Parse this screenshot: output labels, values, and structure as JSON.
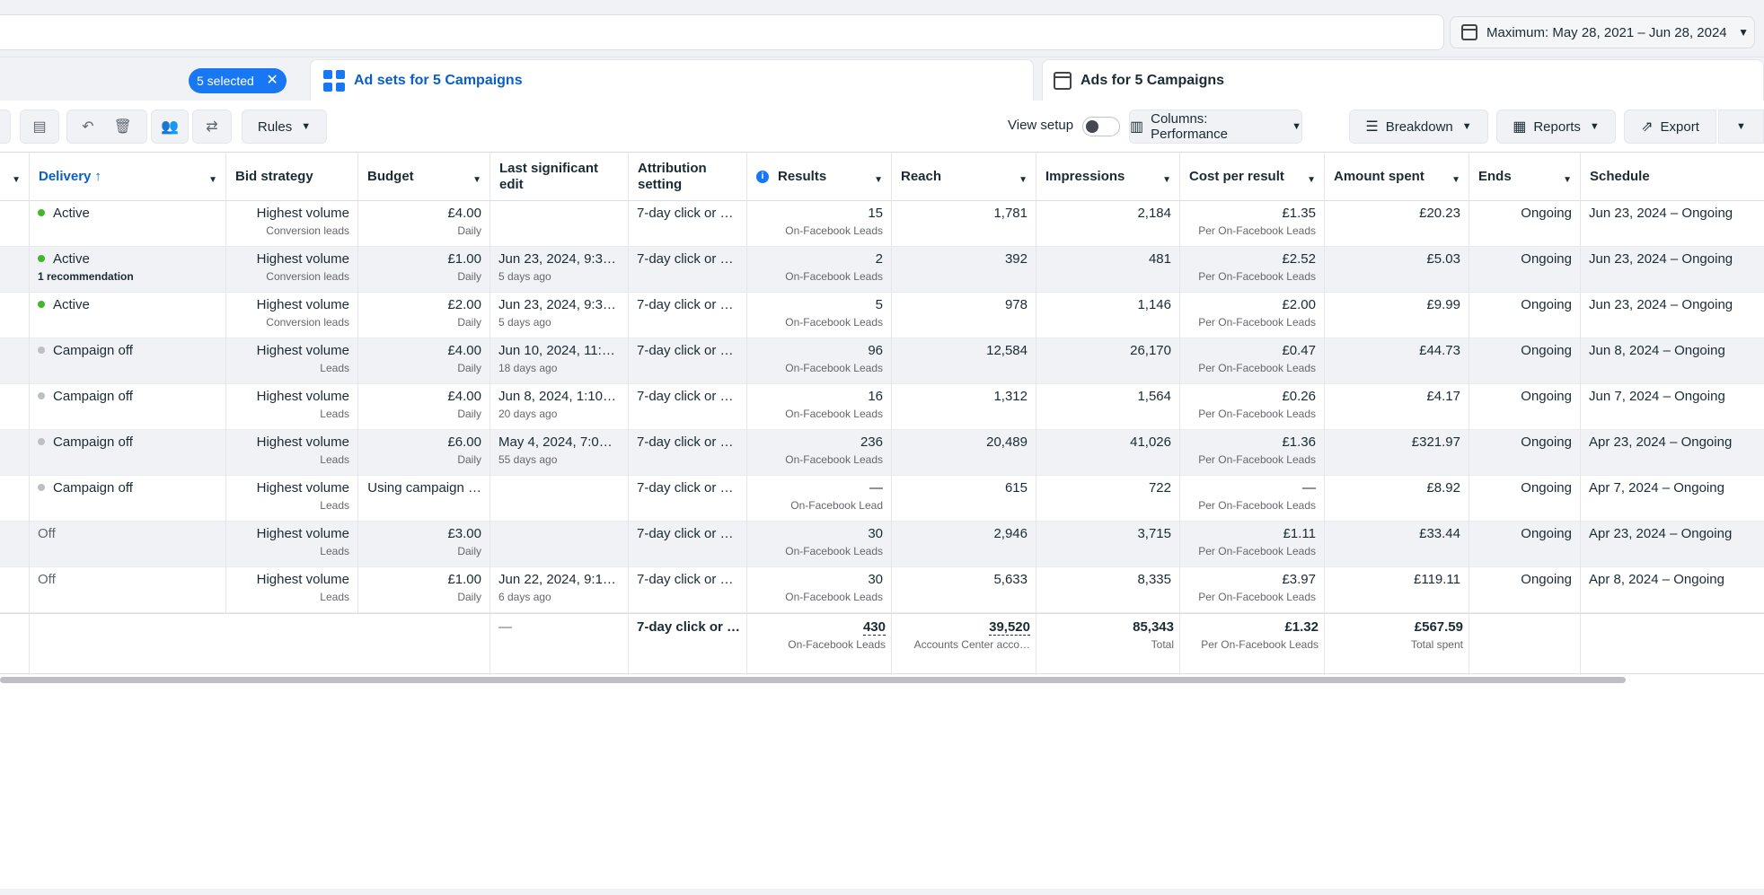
{
  "date_range": {
    "label": "Maximum: May 28, 2021 – Jun 28, 2024"
  },
  "selection": {
    "chip_label": "5 selected",
    "clear": "✕"
  },
  "tabs": {
    "adsets": "Ad sets for 5 Campaigns",
    "ads": "Ads for 5 Campaigns"
  },
  "toolbar": {
    "rules": "Rules",
    "view_setup": "View setup",
    "columns": "Columns: Performance",
    "breakdown": "Breakdown",
    "reports": "Reports",
    "export": "Export"
  },
  "columns": {
    "delivery": "Delivery",
    "bid_strategy": "Bid strategy",
    "budget": "Budget",
    "last_edit": "Last significant edit",
    "attribution": "Attribution setting",
    "results": "Results",
    "reach": "Reach",
    "impressions": "Impressions",
    "cost_per_result": "Cost per result",
    "amount_spent": "Amount spent",
    "ends": "Ends",
    "schedule": "Schedule"
  },
  "rows": [
    {
      "delivery": "Active",
      "delivery_sub": "",
      "status": "active",
      "bid": "Highest volume",
      "bid_sub": "Conversion leads",
      "budget": "£4.00",
      "budget_sub": "Daily",
      "edit": "",
      "edit_sub": "",
      "attribution": "7-day click or 1…",
      "results": "15",
      "results_sub": "On-Facebook Leads",
      "reach": "1,781",
      "impressions": "2,184",
      "cpr": "£1.35",
      "cpr_sub": "Per On-Facebook Leads",
      "spent": "£20.23",
      "ends": "Ongoing",
      "schedule": "Jun 23, 2024 – Ongoing"
    },
    {
      "delivery": "Active",
      "delivery_sub": "1 recommendation",
      "status": "active",
      "bid": "Highest volume",
      "bid_sub": "Conversion leads",
      "budget": "£1.00",
      "budget_sub": "Daily",
      "edit": "Jun 23, 2024, 9:3…",
      "edit_sub": "5 days ago",
      "attribution": "7-day click or 1…",
      "results": "2",
      "results_sub": "On-Facebook Leads",
      "reach": "392",
      "impressions": "481",
      "cpr": "£2.52",
      "cpr_sub": "Per On-Facebook Leads",
      "spent": "£5.03",
      "ends": "Ongoing",
      "schedule": "Jun 23, 2024 – Ongoing"
    },
    {
      "delivery": "Active",
      "delivery_sub": "",
      "status": "active",
      "bid": "Highest volume",
      "bid_sub": "Conversion leads",
      "budget": "£2.00",
      "budget_sub": "Daily",
      "edit": "Jun 23, 2024, 9:3…",
      "edit_sub": "5 days ago",
      "attribution": "7-day click or 1…",
      "results": "5",
      "results_sub": "On-Facebook Leads",
      "reach": "978",
      "impressions": "1,146",
      "cpr": "£2.00",
      "cpr_sub": "Per On-Facebook Leads",
      "spent": "£9.99",
      "ends": "Ongoing",
      "schedule": "Jun 23, 2024 – Ongoing"
    },
    {
      "delivery": "Campaign off",
      "delivery_sub": "",
      "status": "campaign-off",
      "bid": "Highest volume",
      "bid_sub": "Leads",
      "budget": "£4.00",
      "budget_sub": "Daily",
      "edit": "Jun 10, 2024, 11:…",
      "edit_sub": "18 days ago",
      "attribution": "7-day click or 1…",
      "results": "96",
      "results_sub": "On-Facebook Leads",
      "reach": "12,584",
      "impressions": "26,170",
      "cpr": "£0.47",
      "cpr_sub": "Per On-Facebook Leads",
      "spent": "£44.73",
      "ends": "Ongoing",
      "schedule": "Jun 8, 2024 – Ongoing"
    },
    {
      "delivery": "Campaign off",
      "delivery_sub": "",
      "status": "campaign-off",
      "bid": "Highest volume",
      "bid_sub": "Leads",
      "budget": "£4.00",
      "budget_sub": "Daily",
      "edit": "Jun 8, 2024, 1:10 …",
      "edit_sub": "20 days ago",
      "attribution": "7-day click or 1…",
      "results": "16",
      "results_sub": "On-Facebook Leads",
      "reach": "1,312",
      "impressions": "1,564",
      "cpr": "£0.26",
      "cpr_sub": "Per On-Facebook Leads",
      "spent": "£4.17",
      "ends": "Ongoing",
      "schedule": "Jun 7, 2024 – Ongoing"
    },
    {
      "delivery": "Campaign off",
      "delivery_sub": "",
      "status": "campaign-off",
      "bid": "Highest volume",
      "bid_sub": "Leads",
      "budget": "£6.00",
      "budget_sub": "Daily",
      "edit": "May 4, 2024, 7:06 …",
      "edit_sub": "55 days ago",
      "attribution": "7-day click or 1…",
      "results": "236",
      "results_sub": "On-Facebook Leads",
      "reach": "20,489",
      "impressions": "41,026",
      "cpr": "£1.36",
      "cpr_sub": "Per On-Facebook Leads",
      "spent": "£321.97",
      "ends": "Ongoing",
      "schedule": "Apr 23, 2024 – Ongoing"
    },
    {
      "delivery": "Campaign off",
      "delivery_sub": "",
      "status": "campaign-off",
      "bid": "Highest volume",
      "bid_sub": "Leads",
      "budget": "Using campaign …",
      "budget_sub": "",
      "edit": "",
      "edit_sub": "",
      "attribution": "7-day click or 1…",
      "results": "—",
      "results_sub": "On-Facebook Lead",
      "reach": "615",
      "impressions": "722",
      "cpr": "—",
      "cpr_sub": "Per On-Facebook Leads",
      "spent": "£8.92",
      "ends": "Ongoing",
      "schedule": "Apr 7, 2024 – Ongoing"
    },
    {
      "delivery": "Off",
      "delivery_sub": "",
      "status": "off",
      "bid": "Highest volume",
      "bid_sub": "Leads",
      "budget": "£3.00",
      "budget_sub": "Daily",
      "edit": "",
      "edit_sub": "",
      "attribution": "7-day click or 1…",
      "results": "30",
      "results_sub": "On-Facebook Leads",
      "reach": "2,946",
      "impressions": "3,715",
      "cpr": "£1.11",
      "cpr_sub": "Per On-Facebook Leads",
      "spent": "£33.44",
      "ends": "Ongoing",
      "schedule": "Apr 23, 2024 – Ongoing"
    },
    {
      "delivery": "Off",
      "delivery_sub": "",
      "status": "off",
      "bid": "Highest volume",
      "bid_sub": "Leads",
      "budget": "£1.00",
      "budget_sub": "Daily",
      "edit": "Jun 22, 2024, 9:1…",
      "edit_sub": "6 days ago",
      "attribution": "7-day click or 1…",
      "results": "30",
      "results_sub": "On-Facebook Leads",
      "reach": "5,633",
      "impressions": "8,335",
      "cpr": "£3.97",
      "cpr_sub": "Per On-Facebook Leads",
      "spent": "£119.11",
      "ends": "Ongoing",
      "schedule": "Apr 8, 2024 – Ongoing"
    }
  ],
  "totals": {
    "edit": "—",
    "attribution": "7-day click or …",
    "results": "430",
    "results_sub": "On-Facebook Leads",
    "reach": "39,520",
    "reach_sub": "Accounts Center acco…",
    "impressions": "85,343",
    "impressions_sub": "Total",
    "cpr": "£1.32",
    "cpr_sub": "Per On-Facebook Leads",
    "spent": "£567.59",
    "spent_sub": "Total spent"
  },
  "colors": {
    "accent": "#1877f2",
    "active": "#42b72a",
    "off": "#bcc0c4",
    "header_bg": "#f0f2f5"
  },
  "icons": [
    "calendar-icon",
    "close-icon",
    "ad-sets-grid-icon",
    "ads-page-icon",
    "clipboard-icon",
    "undo-icon",
    "delete-icon",
    "people-icon",
    "compare-icon",
    "columns-icon",
    "breakdown-icon",
    "reports-icon",
    "export-icon",
    "info-icon"
  ]
}
